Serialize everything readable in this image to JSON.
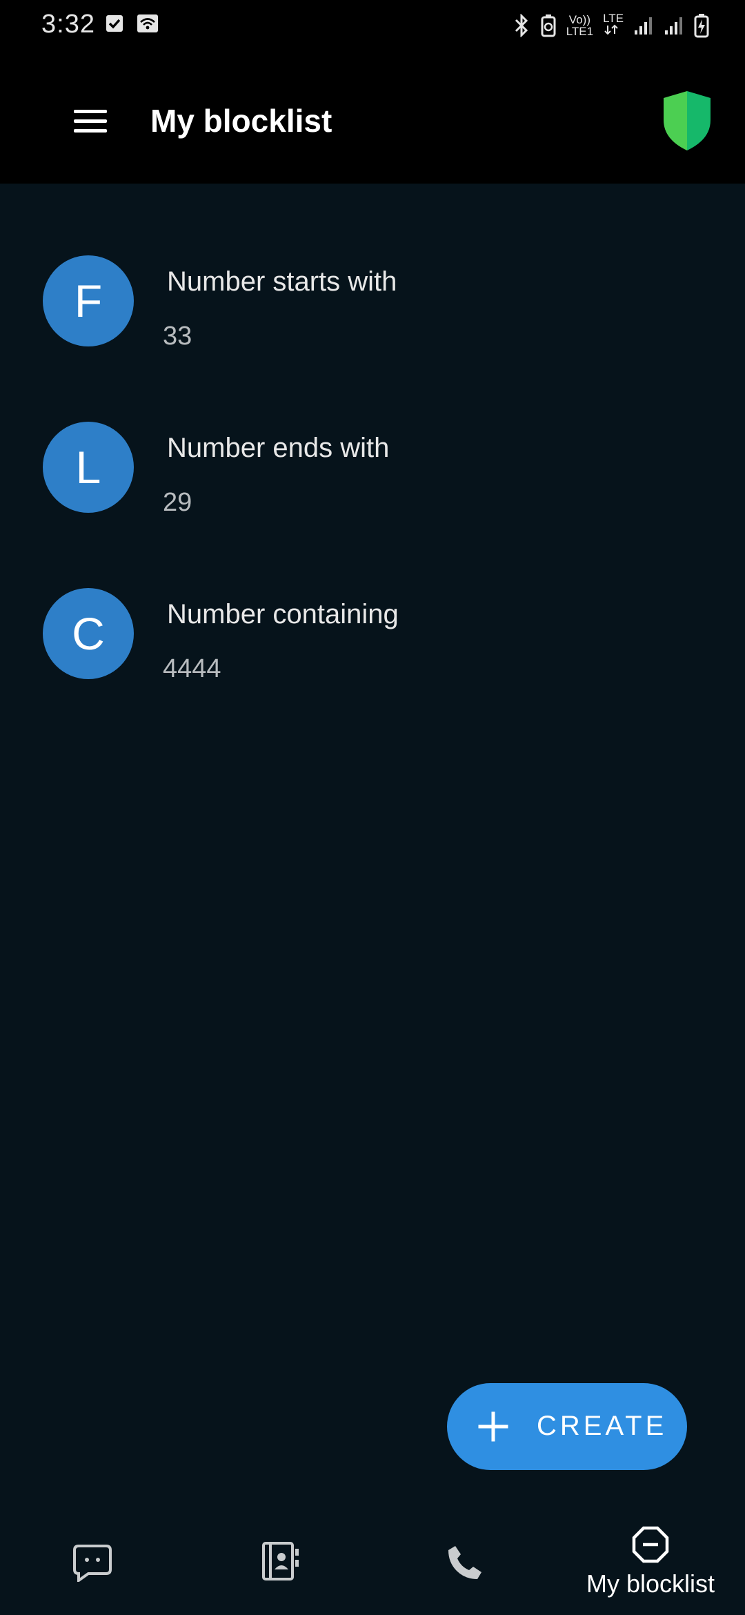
{
  "status_bar": {
    "time": "3:32",
    "volte_line1": "Vo))",
    "volte_line2": "LTE1",
    "lte_label": "LTE"
  },
  "app_bar": {
    "title": "My blocklist"
  },
  "blocklist": {
    "items": [
      {
        "avatar_letter": "F",
        "title": "Number starts with",
        "value": "33"
      },
      {
        "avatar_letter": "L",
        "title": "Number ends with",
        "value": "29"
      },
      {
        "avatar_letter": "C",
        "title": "Number containing",
        "value": "4444"
      }
    ]
  },
  "fab": {
    "label": "CREATE",
    "icon": "plus-icon"
  },
  "bottom_nav": {
    "items": [
      {
        "icon": "messages-icon",
        "label": ""
      },
      {
        "icon": "contacts-icon",
        "label": ""
      },
      {
        "icon": "phone-icon",
        "label": ""
      },
      {
        "icon": "blocklist-icon",
        "label": "My blocklist",
        "active": true
      }
    ]
  },
  "colors": {
    "background": "#06131b",
    "appbar": "#000000",
    "avatar": "#2e7fc8",
    "fab": "#2f8fe2",
    "shield_left": "#4ccf52",
    "shield_right": "#16b86a"
  }
}
